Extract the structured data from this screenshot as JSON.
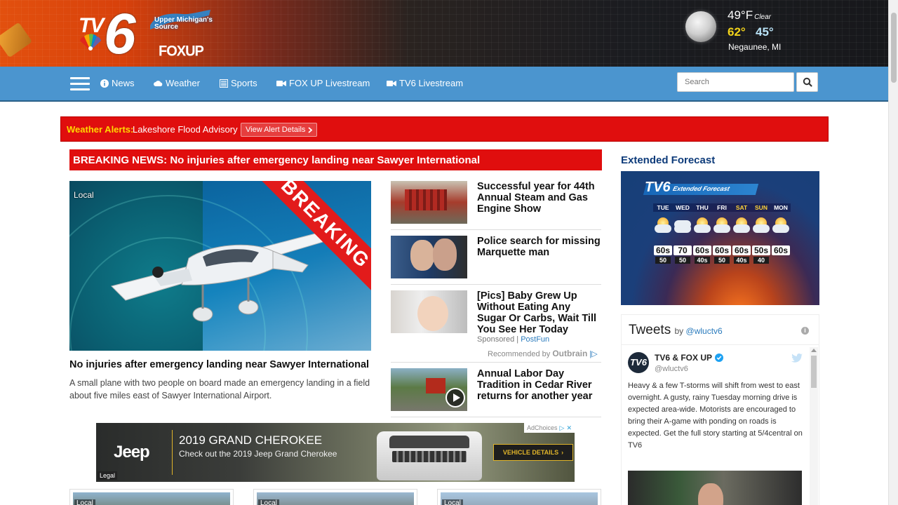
{
  "header": {
    "logo_tv": "TV",
    "logo_six": "6",
    "ups_line1": "Upper Michigan's",
    "ups_line2": "Source",
    "foxup": "FOXUP",
    "weather": {
      "current_temp": "49°F",
      "condition": "Clear",
      "high": "62°",
      "low": "45°",
      "location": "Negaunee, MI"
    }
  },
  "nav": {
    "items": [
      {
        "label": "News",
        "icon": "info-circle-icon"
      },
      {
        "label": "Weather",
        "icon": "cloud-icon"
      },
      {
        "label": "Sports",
        "icon": "newspaper-icon"
      },
      {
        "label": "FOX UP Livestream",
        "icon": "video-camera-icon"
      },
      {
        "label": "TV6 Livestream",
        "icon": "video-camera-icon"
      }
    ],
    "search_placeholder": "Search"
  },
  "alert": {
    "label": "Weather Alerts:",
    "message": "Lakeshore Flood Advisory",
    "button": "View Alert Details"
  },
  "breaking": "BREAKING NEWS: No injuries after emergency landing near Sawyer International",
  "hero": {
    "tag": "Local",
    "ribbon": "BREAKING",
    "title": "No injuries after emergency landing near Sawyer International",
    "description": "A small plane with two people on board made an emergency landing in a field about five miles east of Sawyer International Airport."
  },
  "stories": [
    {
      "title": "Successful year for 44th Annual Steam and Gas Engine Show"
    },
    {
      "title": "Police search for missing Marquette man"
    },
    {
      "title": "[Pics] Baby Grew Up Without Eating Any Sugar Or Carbs, Wait Till You See Her Today"
    },
    {
      "title": "Annual Labor Day Tradition in Cedar River returns for another year"
    }
  ],
  "sponsored": {
    "label": "Sponsored",
    "source": "PostFun",
    "recommended": "Recommended by",
    "brand": "Outbrain"
  },
  "ad": {
    "brand": "Jeep",
    "headline": "2019 GRAND CHEROKEE",
    "sub": "Check out the 2019 Jeep Grand Cherokee",
    "cta": "VEHICLE DETAILS",
    "legal": "Legal",
    "adchoices": "AdChoices"
  },
  "bottom_cards": [
    {
      "tag": "Local"
    },
    {
      "tag": "Local"
    },
    {
      "tag": "Local"
    }
  ],
  "sidebar": {
    "forecast_title": "Extended Forecast",
    "forecast_banner": "Extended Forecast",
    "forecast_logo": "TV6",
    "days": [
      {
        "name": "TUE",
        "hi": "60s",
        "lo": "50",
        "weekend": false
      },
      {
        "name": "WED",
        "hi": "70",
        "lo": "50",
        "weekend": false
      },
      {
        "name": "THU",
        "hi": "60s",
        "lo": "40s",
        "weekend": false
      },
      {
        "name": "FRI",
        "hi": "60s",
        "lo": "50",
        "weekend": false
      },
      {
        "name": "SAT",
        "hi": "60s",
        "lo": "40s",
        "weekend": true
      },
      {
        "name": "SUN",
        "hi": "50s",
        "lo": "40",
        "weekend": true
      },
      {
        "name": "MON",
        "hi": "60s",
        "lo": "",
        "weekend": false
      }
    ],
    "tweets": {
      "title": "Tweets",
      "by": "by",
      "handle_link": "@wluctv6",
      "info": "i",
      "account_name": "TV6 & FOX UP",
      "account_handle": "@wluctv6",
      "avatar": "TV6",
      "text": "Heavy & a few T-storms will shift from west to east overnight. A gusty, rainy Tuesday morning drive is expected area-wide. Motorists are encouraged to bring their A-game with ponding on roads is expected. Get the full story starting at 5/4central on TV6"
    }
  },
  "colors": {
    "nav": "#4b95cf",
    "alert": "#e00e0e",
    "alert_label": "#ffd800",
    "forecast_title": "#0d3b7a",
    "link": "#2a7bbd"
  }
}
